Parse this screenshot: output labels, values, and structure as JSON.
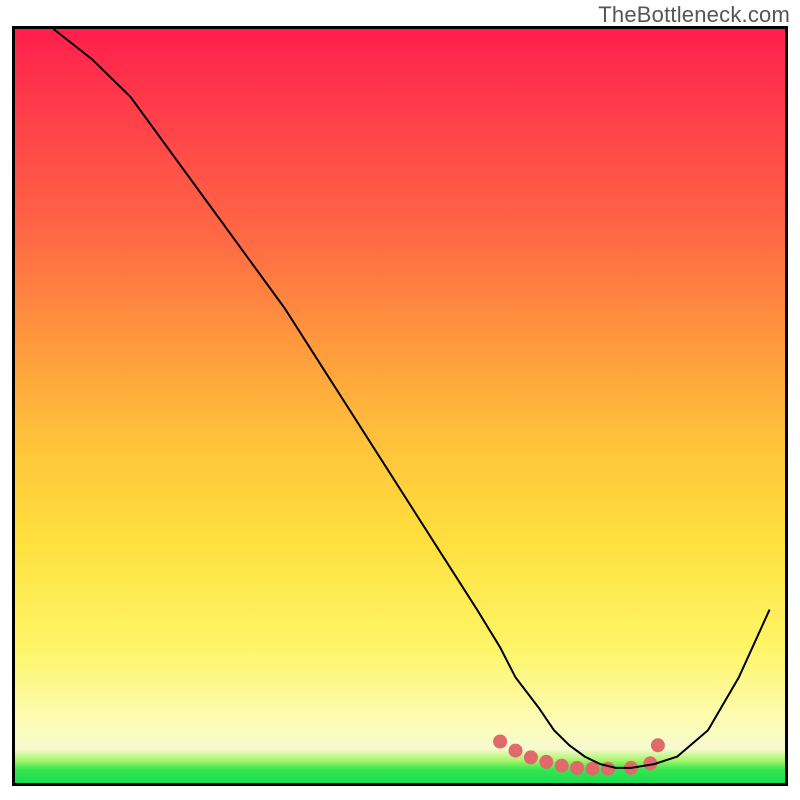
{
  "watermark": "TheBottleneck.com",
  "chart_data": {
    "type": "line",
    "title": "",
    "xlabel": "",
    "ylabel": "",
    "xlim": [
      0,
      100
    ],
    "ylim": [
      0,
      100
    ],
    "grid": false,
    "legend": "none",
    "background_gradient": {
      "direction": "vertical",
      "stops": [
        {
          "pos": 0.0,
          "color": "#ff1f4d"
        },
        {
          "pos": 0.1,
          "color": "#ff3b4a"
        },
        {
          "pos": 0.28,
          "color": "#ff6a44"
        },
        {
          "pos": 0.42,
          "color": "#ff9a3d"
        },
        {
          "pos": 0.55,
          "color": "#ffc33a"
        },
        {
          "pos": 0.68,
          "color": "#ffe03e"
        },
        {
          "pos": 0.82,
          "color": "#fff567"
        },
        {
          "pos": 0.92,
          "color": "#fdfcb6"
        },
        {
          "pos": 0.955,
          "color": "#f7facf"
        },
        {
          "pos": 0.97,
          "color": "#a7f56a"
        },
        {
          "pos": 0.982,
          "color": "#35e64f"
        },
        {
          "pos": 1.0,
          "color": "#18dd50"
        }
      ]
    },
    "series": [
      {
        "name": "bottleneck-curve",
        "color": "#000000",
        "stroke_width": 2,
        "x": [
          5,
          10,
          15,
          20,
          25,
          30,
          35,
          40,
          45,
          50,
          55,
          60,
          63,
          65,
          68,
          70,
          72,
          74,
          76,
          78,
          80,
          83,
          86,
          90,
          94,
          98
        ],
        "y": [
          100,
          96,
          91,
          84,
          77,
          70,
          63,
          55,
          47,
          39,
          31,
          23,
          18,
          14,
          10,
          7,
          5,
          3.5,
          2.5,
          2,
          2,
          2.5,
          3.5,
          7,
          14,
          23
        ]
      }
    ],
    "markers": {
      "name": "min-band-dots",
      "color": "#e06a6a",
      "radius": 7,
      "x": [
        63,
        65,
        67,
        69,
        71,
        73,
        75,
        77,
        80,
        82.5,
        83.5
      ],
      "y": [
        5.5,
        4.3,
        3.4,
        2.8,
        2.3,
        2.0,
        1.9,
        1.9,
        2.0,
        2.6,
        5.0
      ]
    }
  }
}
